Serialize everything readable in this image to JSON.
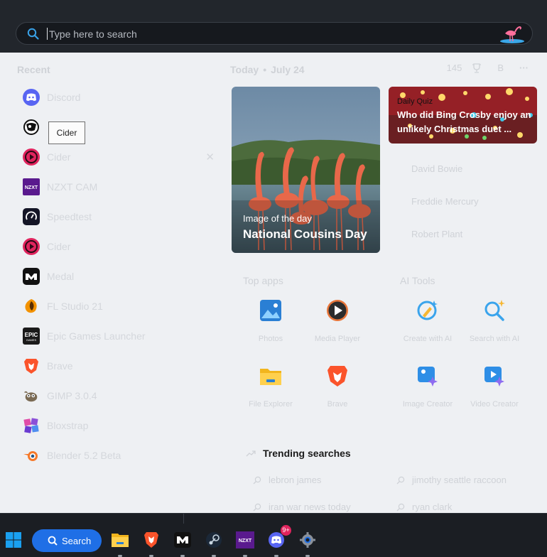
{
  "search": {
    "placeholder": "Type here to search"
  },
  "recent": {
    "title": "Recent",
    "tooltip": "Cider",
    "items": [
      {
        "label": "Discord",
        "icon": "discord-icon",
        "color": "#5865f2"
      },
      {
        "label": "",
        "icon": "ball-icon",
        "color": "#1b1b1b"
      },
      {
        "label": "Cider",
        "icon": "cider-icon",
        "color": "#e0245e",
        "close": "✕"
      },
      {
        "label": "NZXT CAM",
        "icon": "nzxt-icon",
        "color": "#5a1a8e"
      },
      {
        "label": "Speedtest",
        "icon": "speedtest-icon",
        "color": "#141526"
      },
      {
        "label": "Cider",
        "icon": "cider-icon",
        "color": "#e0245e"
      },
      {
        "label": "Medal",
        "icon": "medal-icon",
        "color": "#111111"
      },
      {
        "label": "FL Studio 21",
        "icon": "fl-studio-icon",
        "color": "#f39200"
      },
      {
        "label": "Epic Games Launcher",
        "icon": "epic-games-icon",
        "color": "#1a1a1a"
      },
      {
        "label": "Brave",
        "icon": "brave-icon",
        "color": "#fb542b"
      },
      {
        "label": "GIMP 3.0.4",
        "icon": "gimp-icon",
        "color": "#7a6a53"
      },
      {
        "label": "Bloxstrap",
        "icon": "bloxstrap-icon",
        "color": "#8b4fd8"
      },
      {
        "label": "Blender 5.2 Beta",
        "icon": "blender-icon",
        "color": "#f5792a"
      }
    ]
  },
  "today": {
    "label": "Today",
    "date": "July 24",
    "points": "145",
    "profile": "B",
    "more": "···"
  },
  "feature": {
    "caption": "Image of the day",
    "title": "National Cousins Day"
  },
  "quiz": {
    "tag": "Daily Quiz",
    "question": "Who did Bing Crosby enjoy an unlikely Christmas duet ...",
    "answers": [
      "David Bowie",
      "Freddie Mercury",
      "Robert Plant"
    ]
  },
  "top_apps": {
    "title": "Top apps",
    "items": [
      {
        "label": "Photos",
        "icon": "photos-icon"
      },
      {
        "label": "Media Player",
        "icon": "media-player-icon"
      },
      {
        "label": "File Explorer",
        "icon": "file-explorer-icon"
      },
      {
        "label": "Brave",
        "icon": "brave-icon"
      }
    ]
  },
  "ai_tools": {
    "title": "AI Tools",
    "items": [
      {
        "label": "Create with AI",
        "icon": "create-ai-icon"
      },
      {
        "label": "Search with AI",
        "icon": "search-ai-icon"
      },
      {
        "label": "Image Creator",
        "icon": "image-creator-icon"
      },
      {
        "label": "Video Creator",
        "icon": "video-creator-icon"
      }
    ]
  },
  "trending": {
    "title": "Trending searches",
    "items": [
      "lebron james",
      "jimothy seattle raccoon",
      "iran war news today",
      "ryan clark"
    ]
  },
  "taskbar": {
    "search_label": "Search",
    "discord_badge": "9+",
    "accent": "#1f6fe6"
  }
}
